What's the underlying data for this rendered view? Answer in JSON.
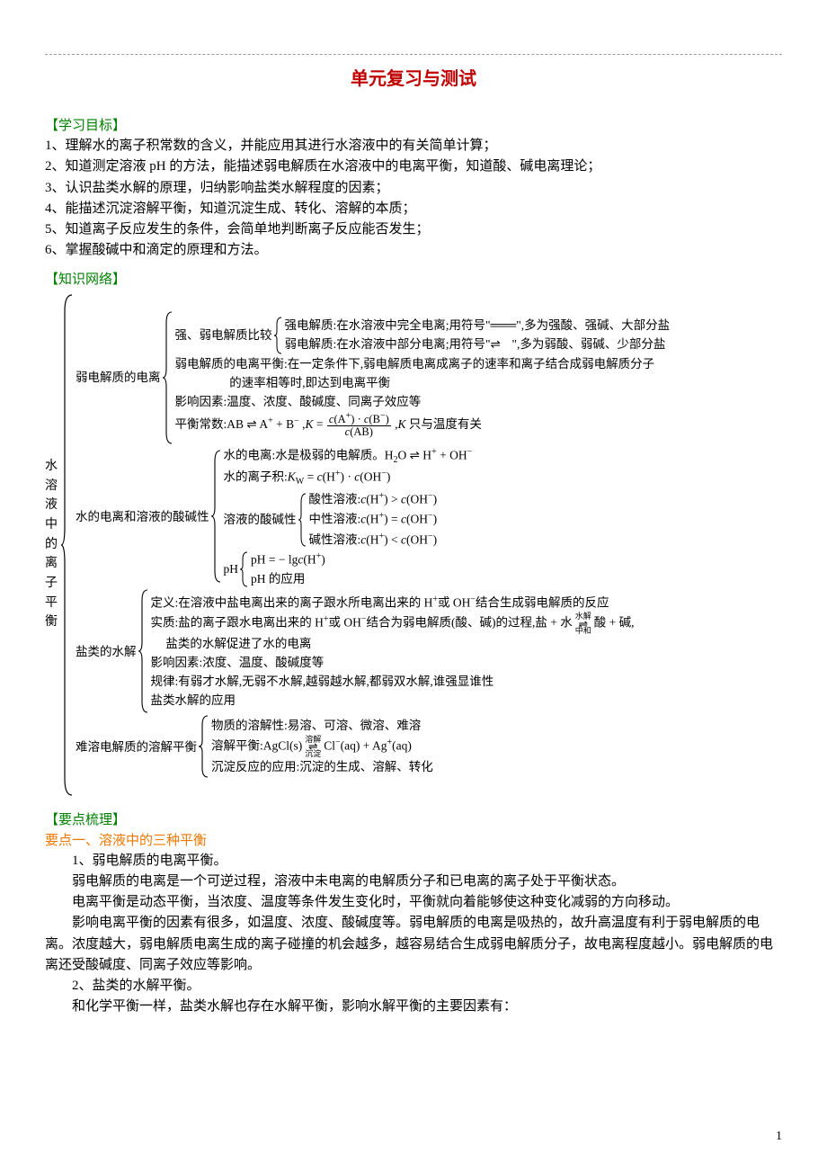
{
  "title": "单元复习与测试",
  "sections": {
    "goals_head": "【学习目标】",
    "goals": [
      "1、理解水的离子积常数的含义，并能应用其进行水溶液中的有关简单计算；",
      "2、知道测定溶液 pH 的方法，能描述弱电解质在水溶液中的电离平衡，知道酸、碱电离理论；",
      "3、认识盐类水解的原理，归纳影响盐类水解程度的因素；",
      "4、能描述沉淀溶解平衡，知道沉淀生成、转化、溶解的本质；",
      "5、知道离子反应发生的条件，会简单地判断离子反应能否发生；",
      "6、掌握酸碱中和滴定的原理和方法。"
    ],
    "network_head": "【知识网络】",
    "summary_head": "【要点梳理】",
    "point1_head": "要点一、溶液中的三种平衡",
    "paras": [
      "1、弱电解质的电离平衡。",
      "弱电解质的电离是一个可逆过程，溶液中未电离的电解质分子和已电离的离子处于平衡状态。",
      "电离平衡是动态平衡，当浓度、温度等条件发生变化时，平衡就向着能够使这种变化减弱的方向移动。",
      "影响电离平衡的因素有很多，如温度、浓度、酸碱度等。弱电解质的电离是吸热的，故升高温度有利于弱电解质的电离。浓度越大，弱电解质电离生成的离子碰撞的机会越多，越容易结合生成弱电解质分子，故电离程度越小。弱电解质的电离还受酸碱度、同离子效应等影响。",
      "2、盐类的水解平衡。",
      "和化学平衡一样，盐类水解也存在水解平衡，影响水解平衡的主要因素有："
    ]
  },
  "chart_data": {
    "type": "tree",
    "root_label": "水溶液中的离子平衡",
    "children": [
      {
        "label": "弱电解质的电离",
        "children": [
          {
            "label": "强、弱电解质比较",
            "children": [
              {
                "text": "强电解质：在水溶液中完全电离；用符号\"═\"，多为强酸、强碱、大部分盐"
              },
              {
                "text": "弱电解质：在水溶液中部分电离；用符号\"⇌\"，多为弱酸、弱碱、少部分盐"
              }
            ]
          },
          {
            "text": "弱电解质的电离平衡：在一定条件下，弱电解质电离成离子的速率和离子结合成弱电解质分子的速率相等时，即达到电离平衡"
          },
          {
            "text": "影响因素：温度、浓度、酸碱度、同离子效应等"
          },
          {
            "text": "平衡常数：AB ⇌ A⁺ + B⁻，K = c(A⁺)·c(B⁻) / c(AB)，K 只与温度有关"
          }
        ]
      },
      {
        "label": "水的电离和溶液的酸碱性",
        "children": [
          {
            "text": "水的电离：水是极弱的电解质。H₂O ⇌ H⁺ + OH⁻"
          },
          {
            "text": "水的离子积：Kw = c(H⁺)·c(OH⁻)"
          },
          {
            "label": "溶液的酸碱性",
            "children": [
              {
                "text": "酸性溶液：c(H⁺) > c(OH⁻)"
              },
              {
                "text": "中性溶液：c(H⁺) = c(OH⁻)"
              },
              {
                "text": "碱性溶液：c(H⁺) < c(OH⁻)"
              }
            ]
          },
          {
            "label": "pH",
            "children": [
              {
                "text": "pH = −lg c(H⁺)"
              },
              {
                "text": "pH 的应用"
              }
            ]
          }
        ]
      },
      {
        "label": "盐类的水解",
        "children": [
          {
            "text": "定义：在溶液中盐电离出来的离子跟水所电离出来的 H⁺或 OH⁻结合生成弱电解质的反应"
          },
          {
            "text": "实质：盐的离子跟水电离出来的 H⁺或 OH⁻结合为弱电解质(酸、碱)的过程，盐 + 水 ⇌(水解/中和) 酸 + 碱，盐类的水解促进了水的电离"
          },
          {
            "text": "影响因素：浓度、温度、酸碱度等"
          },
          {
            "text": "规律：有弱才水解，无弱不水解，越弱越水解，都弱双水解，谁强显谁性"
          },
          {
            "text": "盐类水解的应用"
          }
        ]
      },
      {
        "label": "难溶电解质的溶解平衡",
        "children": [
          {
            "text": "物质的溶解性：易溶、可溶、微溶、难溶"
          },
          {
            "text": "溶解平衡：AgCl(s) ⇌(溶解/沉淀) Cl⁻(aq) + Ag⁺(aq)"
          },
          {
            "text": "沉淀反应的应用：沉淀的生成、溶解、转化"
          }
        ]
      }
    ]
  },
  "page_number": "1"
}
